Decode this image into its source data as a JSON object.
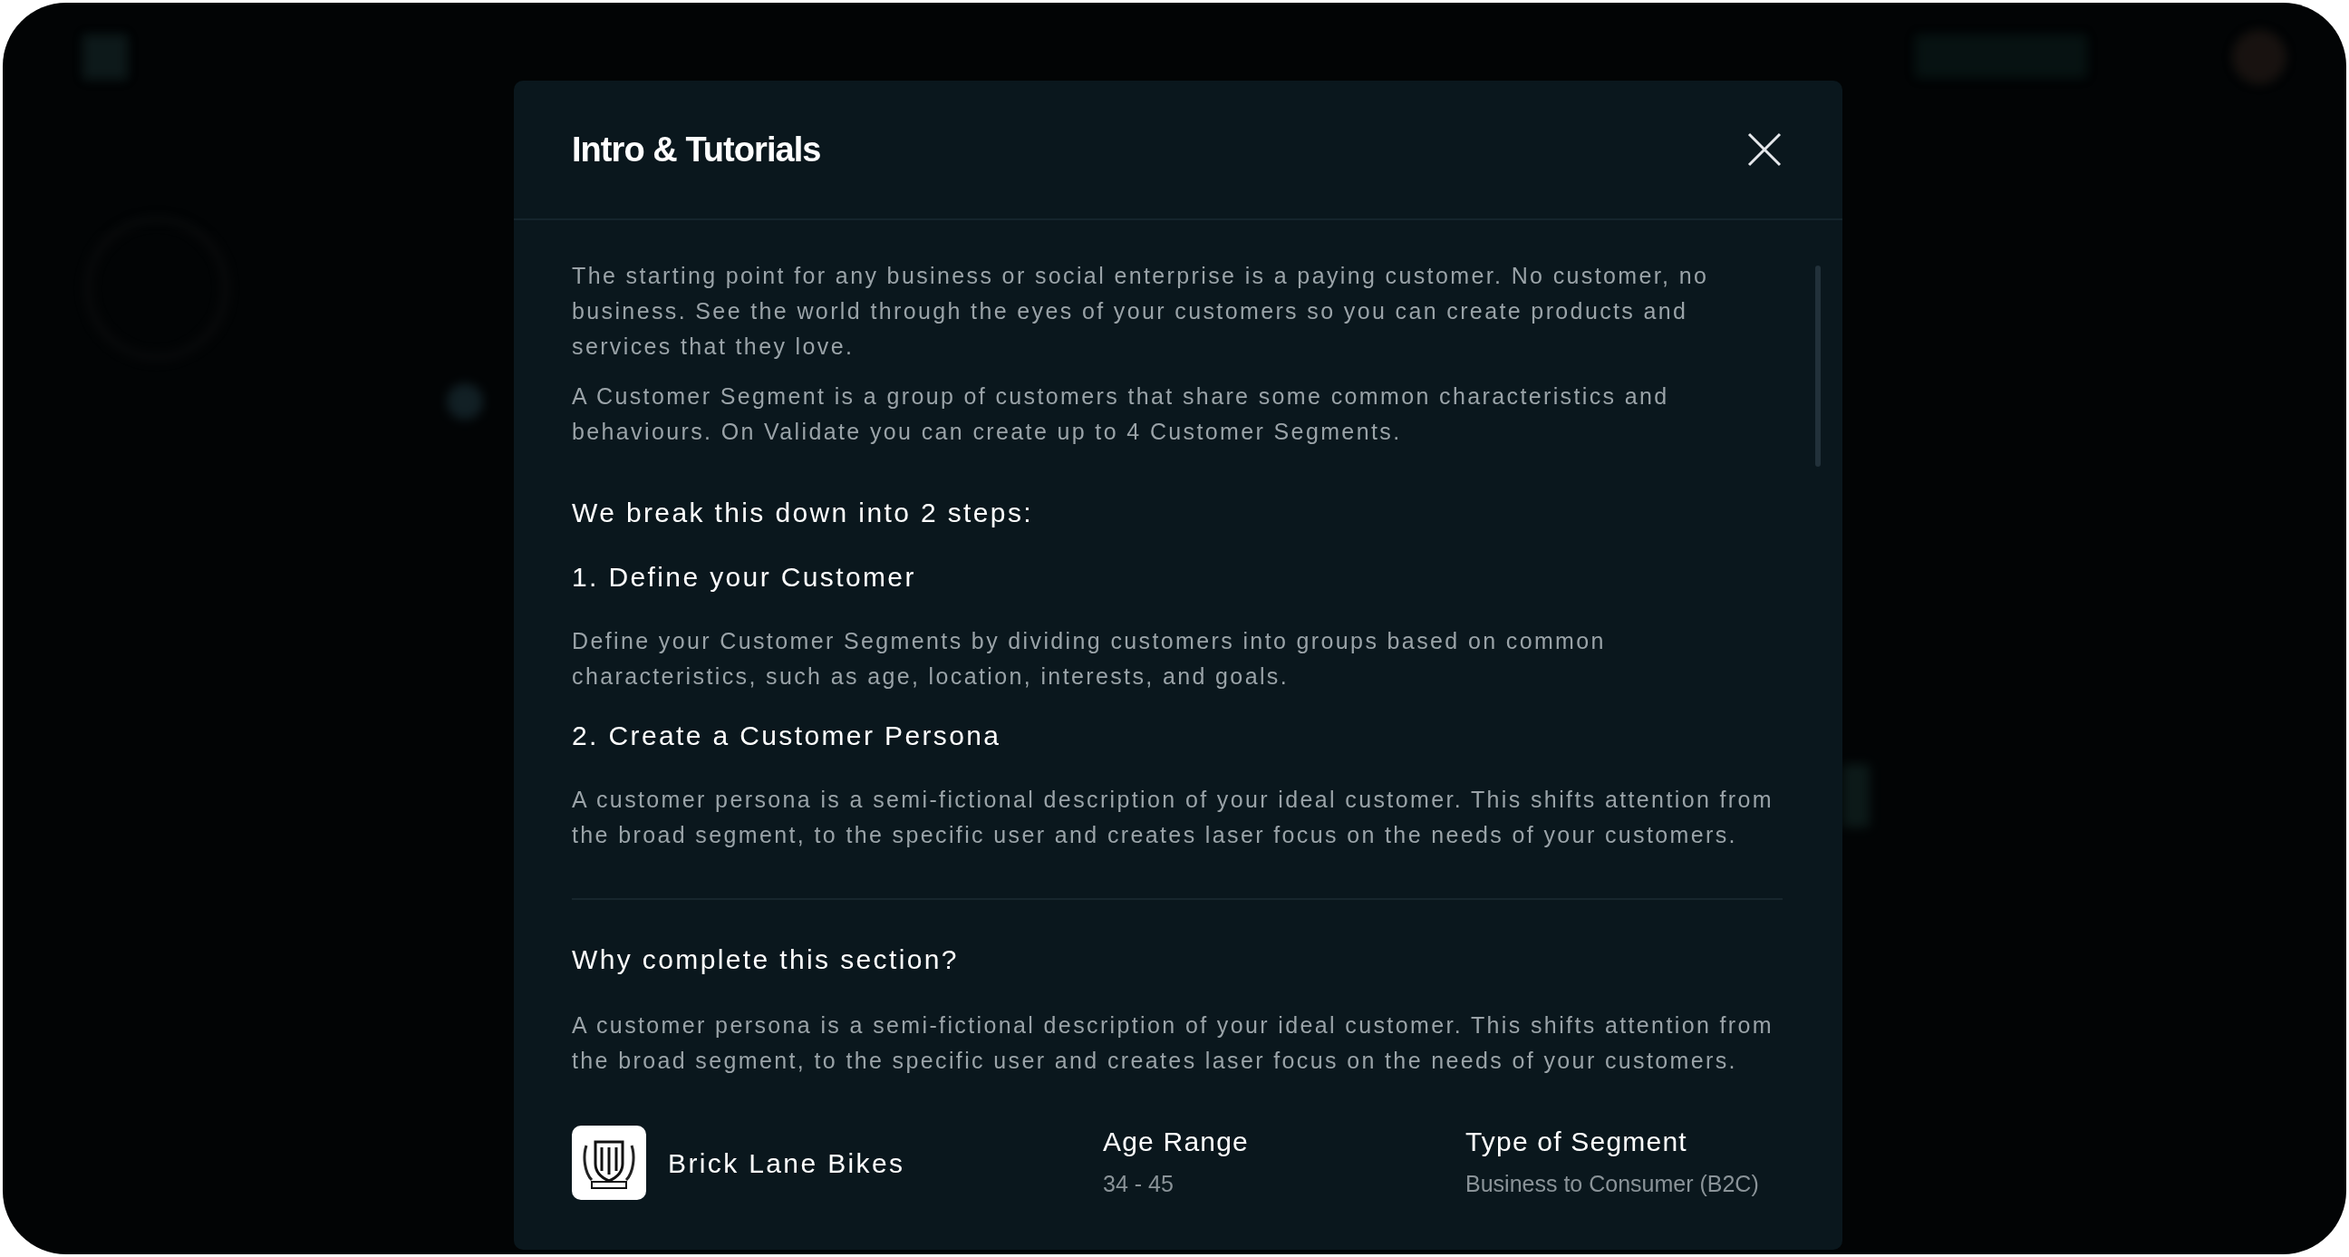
{
  "modal": {
    "title": "Intro & Tutorials",
    "intro": [
      "The starting point for any business or social enterprise is a paying customer. No customer, no business. See the world through the eyes of your customers so you can create products and services that they love.",
      "A Customer Segment is a group of customers that share some common characteristics and behaviours. On Validate you can create up to 4 Customer Segments."
    ],
    "steps_heading": "We break this down into 2 steps:",
    "steps": [
      {
        "title": "1. Define your Customer",
        "description": "Define your Customer Segments by dividing customers into groups based on common characteristics, such as age, location, interests, and goals."
      },
      {
        "title": "2. Create a Customer Persona",
        "description": "A customer persona is a semi-fictional description of your ideal customer. This shifts attention from the broad segment, to the specific user and creates laser focus on the needs of your customers."
      }
    ],
    "why": {
      "heading": "Why complete this section?",
      "text": "A customer persona is a semi-fictional description of your ideal customer. This shifts attention from the broad segment, to the specific user and creates laser focus on the needs of your customers."
    },
    "segment": {
      "name": "Brick Lane Bikes",
      "fields": [
        {
          "label": "Age Range",
          "value": "34 - 45"
        },
        {
          "label": "Type of Segment",
          "value": "Business to Consumer (B2C)"
        }
      ]
    }
  }
}
